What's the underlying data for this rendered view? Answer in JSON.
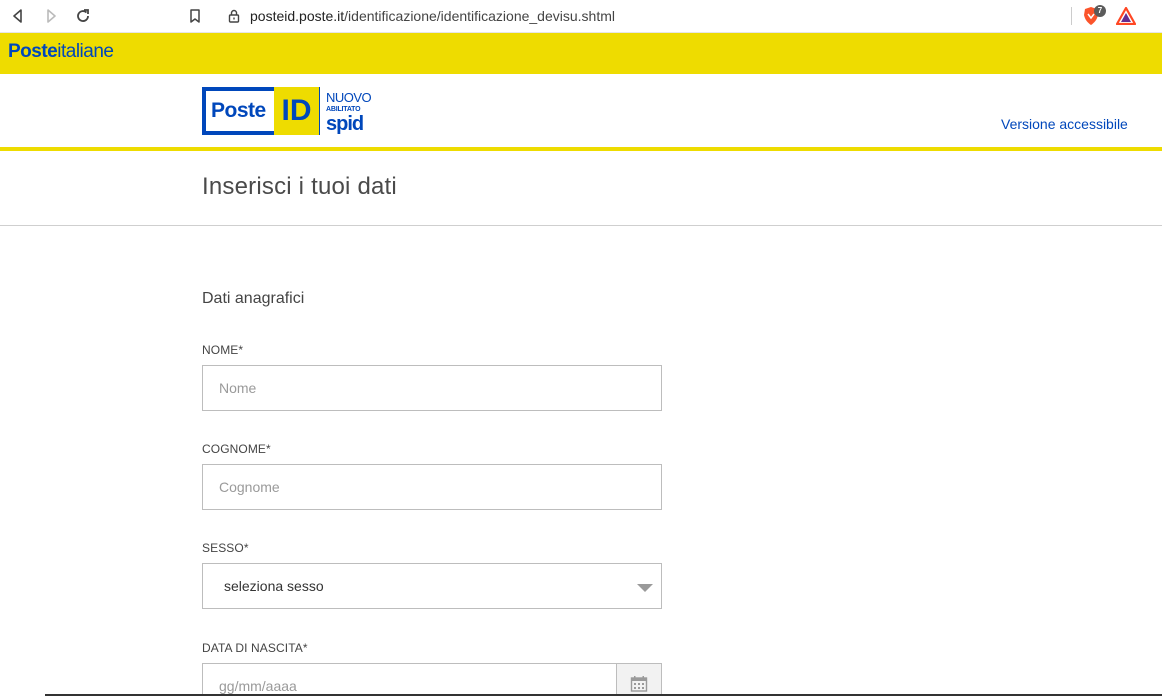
{
  "browser": {
    "url_host": "posteid.poste.it",
    "url_path": "/identificazione/identificazione_devisu.shtml",
    "brave_badge": "7",
    "icons": [
      "back-icon",
      "forward-icon",
      "reload-icon",
      "bookmark-icon",
      "lock-icon",
      "brave-shield-icon",
      "brave-rewards-icon"
    ]
  },
  "banner": {
    "brand_bold": "Poste",
    "brand_light": "italiane"
  },
  "header": {
    "logo": {
      "poste": "Poste",
      "id": "ID",
      "nuovo": "NUOVO",
      "abilitato": "ABILITATO",
      "spid": "spid"
    },
    "accessible_link": "Versione accessibile"
  },
  "page": {
    "title": "Inserisci i tuoi dati"
  },
  "form": {
    "section_title": "Dati anagrafici",
    "nome": {
      "label": "NOME*",
      "placeholder": "Nome",
      "value": ""
    },
    "cognome": {
      "label": "COGNOME*",
      "placeholder": "Cognome",
      "value": ""
    },
    "sesso": {
      "label": "SESSO*",
      "selected": "seleziona sesso"
    },
    "data_nascita": {
      "label": "DATA DI NASCITA*",
      "placeholder": "gg/mm/aaaa",
      "value": ""
    }
  },
  "colors": {
    "brand_yellow": "#eedc00",
    "brand_blue": "#0047bb"
  }
}
